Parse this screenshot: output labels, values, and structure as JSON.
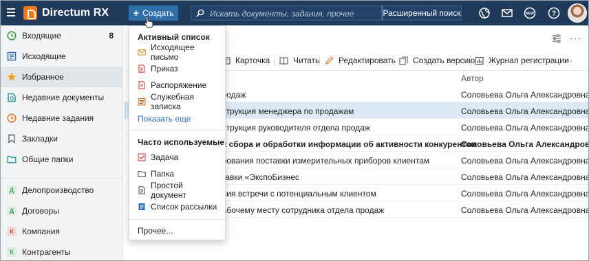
{
  "app": {
    "title": "Directum RX"
  },
  "header": {
    "create_label": "Создать",
    "search_placeholder": "Искать документы, задания, прочее",
    "advanced_search_label": "Расширенный поиск",
    "icons": [
      "globe-icon",
      "mail-icon",
      "new-badge-icon",
      "help-icon",
      "avatar"
    ],
    "new_badge_text": "NEW"
  },
  "sidebar": {
    "items": [
      {
        "label": "Входящие",
        "count": "8",
        "icon": "inbox-icon"
      },
      {
        "label": "Исходящие",
        "icon": "outbox-icon"
      },
      {
        "label": "Избранное",
        "icon": "star-icon"
      },
      {
        "label": "Недавние документы",
        "icon": "recent-docs-icon"
      },
      {
        "label": "Недавние задания",
        "icon": "recent-tasks-icon"
      },
      {
        "label": "Закладки",
        "icon": "bookmark-icon"
      },
      {
        "label": "Общие папки",
        "icon": "folder-icon"
      }
    ],
    "modules": [
      {
        "letter": "Д",
        "label": "Делопроизводство",
        "color": "#4a9b5c"
      },
      {
        "letter": "Д",
        "label": "Договоры",
        "color": "#4a9b5c"
      },
      {
        "letter": "К",
        "label": "Компания",
        "color": "#d0453c"
      },
      {
        "letter": "К",
        "label": "Контрагенты",
        "color": "#4a9b5c"
      }
    ]
  },
  "toolbar": {
    "card": "Карточка",
    "read": "Читать",
    "edit": "Редактировать",
    "create_version": "Создать версию",
    "registration_log": "Журнал регистрации",
    "more": "···"
  },
  "table": {
    "author_header": "Автор",
    "rows": [
      {
        "name": "продаж",
        "author": "Соловьева Ольга Александровна",
        "selected": false,
        "bold": false
      },
      {
        "name": "нструкция менеджера по продажам",
        "author": "Соловьева Ольга Александровна",
        "selected": true,
        "bold": false
      },
      {
        "name": "нструкция руководителя отдела продаж",
        "author": "Соловьева Ольга Александровна",
        "selected": false,
        "bold": false
      },
      {
        "name": "ок сбора и обработки информации об активности конкурентов",
        "author": "Соловьева Ольга Александровна",
        "selected": false,
        "bold": true
      },
      {
        "name": "ирования поставки измерительных приборов клиентам",
        "author": "Соловьева Ольга Александровна",
        "selected": false,
        "bold": false
      },
      {
        "name": "ставки «ЭкспоБизнес",
        "author": "Соловьева Ольга Александровна",
        "selected": false,
        "bold": false
      },
      {
        "name": "ения встречи с потенциальным клиентом",
        "author": "Соловьева Ольга Александровна",
        "selected": false,
        "bold": false
      },
      {
        "name": "рабочему месту сотрудника отдела продаж",
        "author": "Соловьева Ольга Александровна",
        "selected": false,
        "bold": false
      }
    ]
  },
  "dropdown": {
    "active_list_header": "Активный список",
    "active_items": [
      {
        "label": "Исходящее письмо",
        "icon": "outgoing-letter-icon"
      },
      {
        "label": "Приказ",
        "icon": "order-icon"
      },
      {
        "label": "Распоряжение",
        "icon": "directive-icon"
      },
      {
        "label": "Служебная записка",
        "icon": "memo-icon"
      }
    ],
    "show_more": "Показать еще",
    "frequent_header": "Часто используемые",
    "frequent_items": [
      {
        "label": "Задача",
        "icon": "task-icon"
      },
      {
        "label": "Папка",
        "icon": "folder-icon"
      },
      {
        "label": "Простой документ",
        "icon": "simple-document-icon"
      },
      {
        "label": "Список рассылки",
        "icon": "mailing-list-icon"
      }
    ],
    "other": "Прочее..."
  },
  "colors": {
    "header_bg": "#1f3a5a",
    "create_button": "#2f6ea8",
    "logo": "#f07a19",
    "link": "#2e6db2",
    "selected_row": "#dde9f5"
  }
}
